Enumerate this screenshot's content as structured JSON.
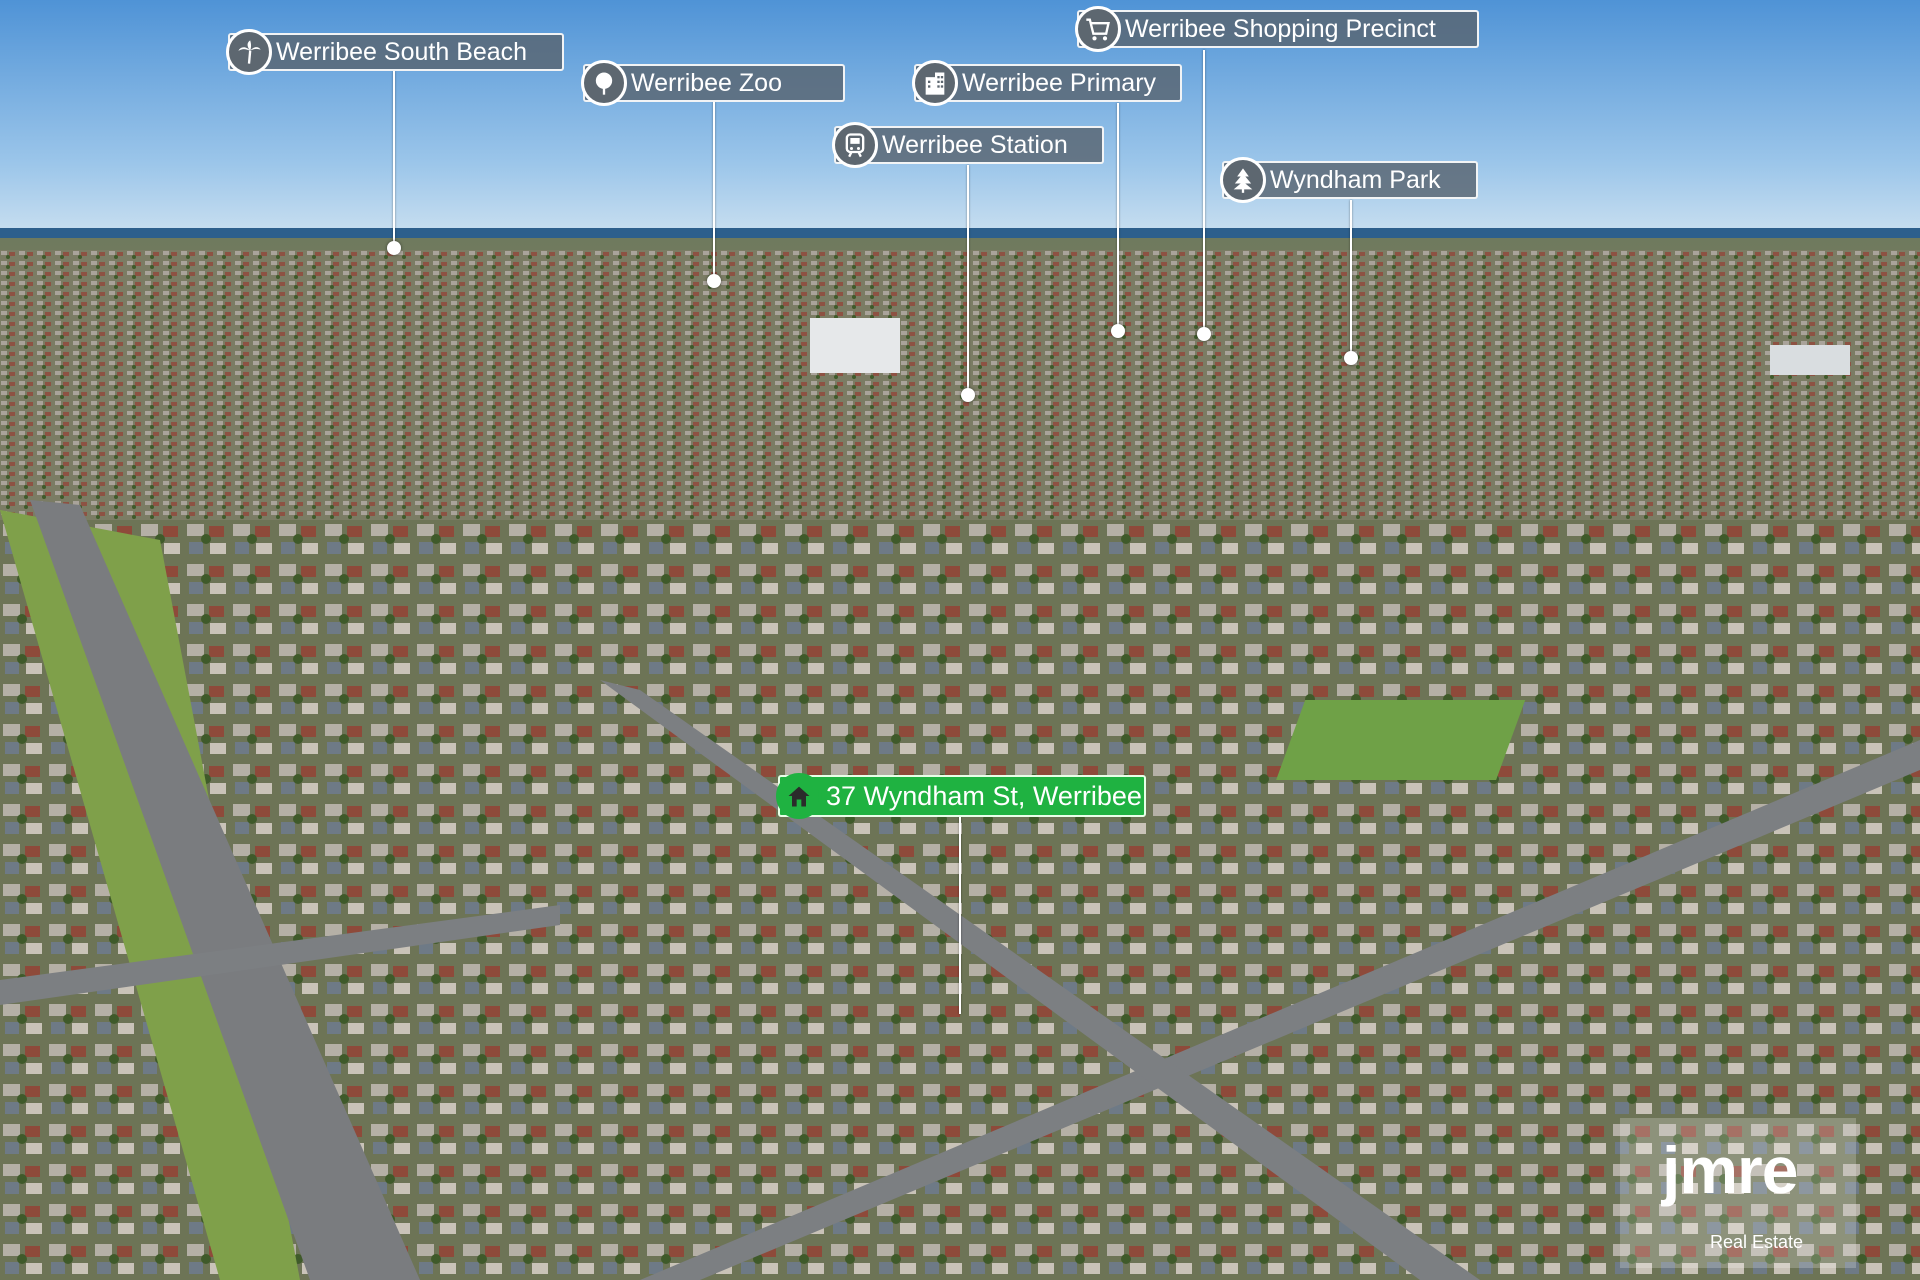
{
  "points_of_interest": [
    {
      "label": "Werribee South Beach",
      "icon": "palm-tree-icon"
    },
    {
      "label": "Werribee Zoo",
      "icon": "tree-icon"
    },
    {
      "label": "Werribee Station",
      "icon": "train-icon"
    },
    {
      "label": "Werribee Primary",
      "icon": "building-icon"
    },
    {
      "label": "Werribee Shopping Precinct",
      "icon": "shopping-cart-icon"
    },
    {
      "label": "Wyndham Park",
      "icon": "pine-tree-icon"
    }
  ],
  "property": {
    "label": "37 Wyndham St, Werribee",
    "icon": "house-icon"
  },
  "watermark": {
    "brand": "jmre",
    "tagline": "Real Estate"
  },
  "colors": {
    "property_label": "#1fb241",
    "poi_label": "#5d6770",
    "sky": "#6fa9dc"
  }
}
